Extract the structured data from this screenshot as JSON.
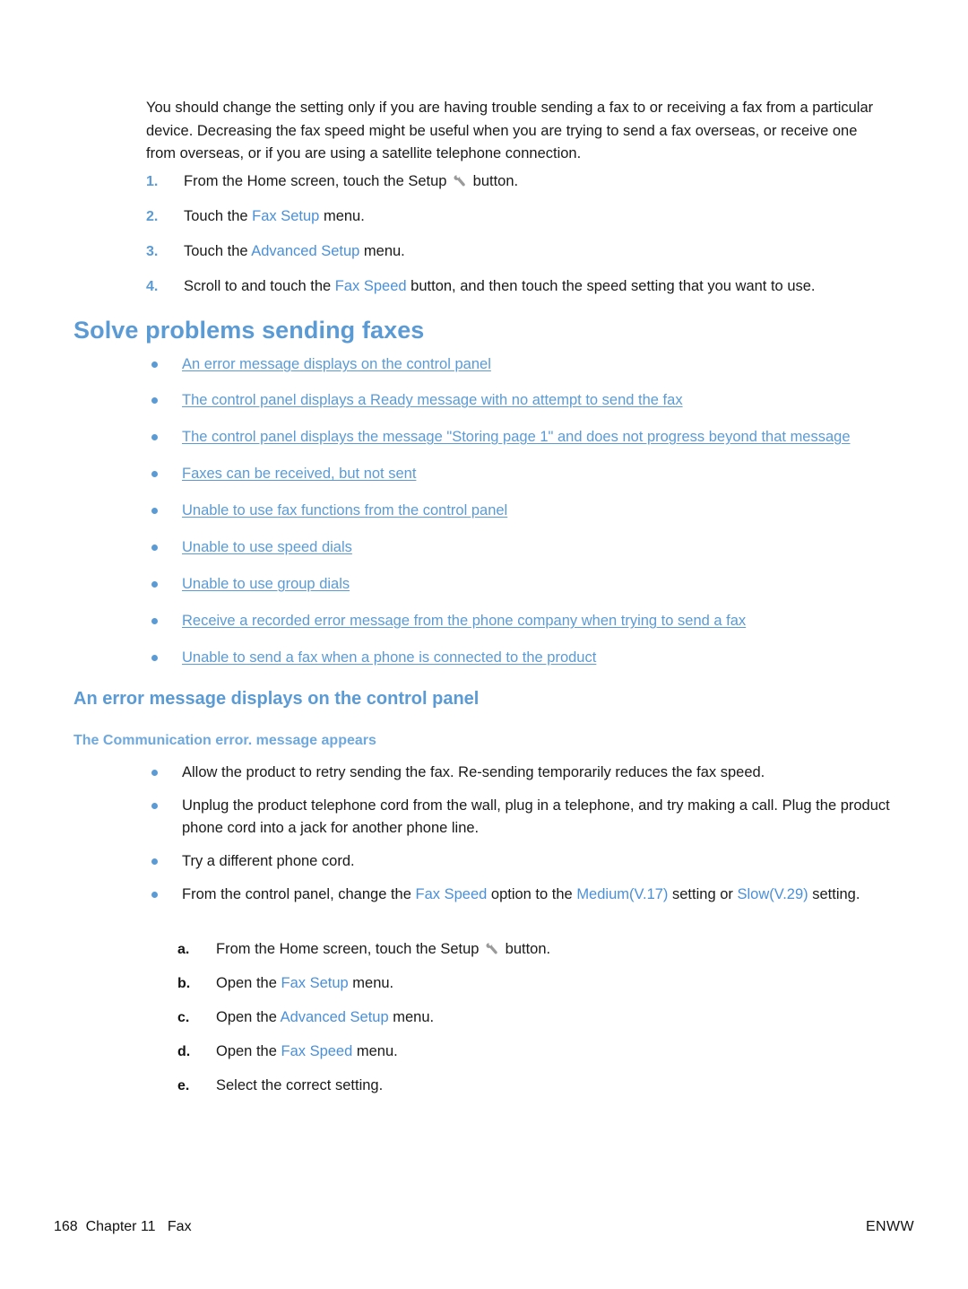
{
  "page": {
    "intro_paragraph": "You should change the setting only if you are having trouble sending a fax to or receiving a fax from a particular device. Decreasing the fax speed might be useful when you are trying to send a fax overseas, or receive one from overseas, or if you are using a satellite telephone connection."
  },
  "colors": {
    "heading_blue": "#5b9bd5",
    "link_blue": "#5b9bd5",
    "ui_term_blue": "#4a90d9",
    "bullet_blue": "#5b9bd5",
    "body_text": "#1a1a1a"
  },
  "steps_top": [
    {
      "marker": "1.",
      "pre": "From the Home screen, touch the Setup ",
      "icon": "wrench-icon",
      "post": " button."
    },
    {
      "marker": "2.",
      "pre": "Touch the ",
      "term": "Fax Setup",
      "post": " menu."
    },
    {
      "marker": "3.",
      "pre": "Touch the ",
      "term": "Advanced Setup",
      "post": " menu."
    },
    {
      "marker": "4.",
      "pre": "Scroll to and touch the ",
      "term": "Fax Speed",
      "post": " button, and then touch the speed setting that you want to use."
    }
  ],
  "main_heading": "Solve problems sending faxes",
  "link_list": [
    "An error message displays on the control panel",
    "The control panel displays a Ready message with no attempt to send the fax",
    "The control panel displays the message \"Storing page 1\" and does not progress beyond that message",
    "Faxes can be received, but not sent",
    "Unable to use fax functions from the control panel",
    "Unable to use speed dials",
    "Unable to use group dials",
    "Receive a recorded error message from the phone company when trying to send a fax",
    "Unable to send a fax when a phone is connected to the product"
  ],
  "section_heading": "An error message displays on the control panel",
  "subsection_heading": "The Communication error. message appears",
  "remedy_bullets": [
    {
      "text": "Allow the product to retry sending the fax. Re-sending temporarily reduces the fax speed."
    },
    {
      "text": "Unplug the product telephone cord from the wall, plug in a telephone, and try making a call. Plug the product phone cord into a jack for another phone line."
    },
    {
      "text": "Try a different phone cord."
    },
    {
      "pre": "From the control panel, change the ",
      "term1": "Fax Speed",
      "mid1": " option to the ",
      "term2": "Medium(V.17)",
      "mid2": " setting or ",
      "term3": "Slow(V.29)",
      "post": " setting."
    }
  ],
  "steps_sub": [
    {
      "marker": "a.",
      "pre": "From the Home screen, touch the Setup ",
      "icon": "wrench-icon",
      "post": " button."
    },
    {
      "marker": "b.",
      "pre": "Open the ",
      "term": "Fax Setup",
      "post": " menu."
    },
    {
      "marker": "c.",
      "pre": "Open the ",
      "term": "Advanced Setup",
      "post": " menu."
    },
    {
      "marker": "d.",
      "pre": "Open the ",
      "term": "Fax Speed",
      "post": " menu."
    },
    {
      "marker": "e.",
      "pre": "Select the correct setting.",
      "post": ""
    }
  ],
  "footer": {
    "left": "168  Chapter 11   Fax",
    "right": "ENWW"
  }
}
